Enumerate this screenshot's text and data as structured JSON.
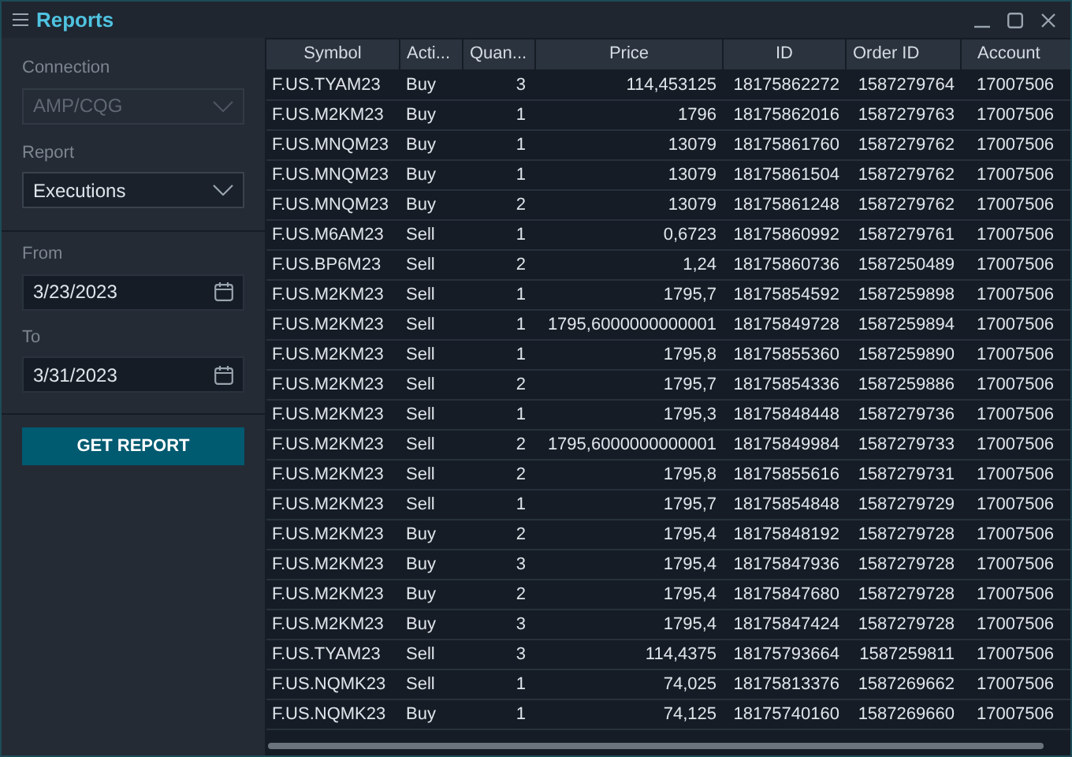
{
  "window": {
    "title": "Reports"
  },
  "sidebar": {
    "connection": {
      "label": "Connection",
      "value": "AMP/CQG",
      "disabled": true
    },
    "report": {
      "label": "Report",
      "value": "Executions",
      "disabled": false
    },
    "from": {
      "label": "From",
      "value": "3/23/2023"
    },
    "to": {
      "label": "To",
      "value": "3/31/2023"
    },
    "button": "GET REPORT"
  },
  "table": {
    "columns": [
      "Symbol",
      "Acti...",
      "Quan...",
      "Price",
      "ID",
      "Order ID",
      "Account"
    ],
    "rows": [
      [
        "F.US.TYAM23",
        "Buy",
        "3",
        "114,453125",
        "18175862272",
        "1587279764",
        "17007506"
      ],
      [
        "F.US.M2KM23",
        "Buy",
        "1",
        "1796",
        "18175862016",
        "1587279763",
        "17007506"
      ],
      [
        "F.US.MNQM23",
        "Buy",
        "1",
        "13079",
        "18175861760",
        "1587279762",
        "17007506"
      ],
      [
        "F.US.MNQM23",
        "Buy",
        "1",
        "13079",
        "18175861504",
        "1587279762",
        "17007506"
      ],
      [
        "F.US.MNQM23",
        "Buy",
        "2",
        "13079",
        "18175861248",
        "1587279762",
        "17007506"
      ],
      [
        "F.US.M6AM23",
        "Sell",
        "1",
        "0,6723",
        "18175860992",
        "1587279761",
        "17007506"
      ],
      [
        "F.US.BP6M23",
        "Sell",
        "2",
        "1,24",
        "18175860736",
        "1587250489",
        "17007506"
      ],
      [
        "F.US.M2KM23",
        "Sell",
        "1",
        "1795,7",
        "18175854592",
        "1587259898",
        "17007506"
      ],
      [
        "F.US.M2KM23",
        "Sell",
        "1",
        "1795,6000000000001",
        "18175849728",
        "1587259894",
        "17007506"
      ],
      [
        "F.US.M2KM23",
        "Sell",
        "1",
        "1795,8",
        "18175855360",
        "1587259890",
        "17007506"
      ],
      [
        "F.US.M2KM23",
        "Sell",
        "2",
        "1795,7",
        "18175854336",
        "1587259886",
        "17007506"
      ],
      [
        "F.US.M2KM23",
        "Sell",
        "1",
        "1795,3",
        "18175848448",
        "1587279736",
        "17007506"
      ],
      [
        "F.US.M2KM23",
        "Sell",
        "2",
        "1795,6000000000001",
        "18175849984",
        "1587279733",
        "17007506"
      ],
      [
        "F.US.M2KM23",
        "Sell",
        "2",
        "1795,8",
        "18175855616",
        "1587279731",
        "17007506"
      ],
      [
        "F.US.M2KM23",
        "Sell",
        "1",
        "1795,7",
        "18175854848",
        "1587279729",
        "17007506"
      ],
      [
        "F.US.M2KM23",
        "Buy",
        "2",
        "1795,4",
        "18175848192",
        "1587279728",
        "17007506"
      ],
      [
        "F.US.M2KM23",
        "Buy",
        "3",
        "1795,4",
        "18175847936",
        "1587279728",
        "17007506"
      ],
      [
        "F.US.M2KM23",
        "Buy",
        "2",
        "1795,4",
        "18175847680",
        "1587279728",
        "17007506"
      ],
      [
        "F.US.M2KM23",
        "Buy",
        "3",
        "1795,4",
        "18175847424",
        "1587279728",
        "17007506"
      ],
      [
        "F.US.TYAM23",
        "Sell",
        "3",
        "114,4375",
        "18175793664",
        "1587259811",
        "17007506"
      ],
      [
        "F.US.NQMK23",
        "Sell",
        "1",
        "74,025",
        "18175813376",
        "1587269662",
        "17007506"
      ],
      [
        "F.US.NQMK23",
        "Buy",
        "1",
        "74,125",
        "18175740160",
        "1587269660",
        "17007506"
      ]
    ]
  }
}
